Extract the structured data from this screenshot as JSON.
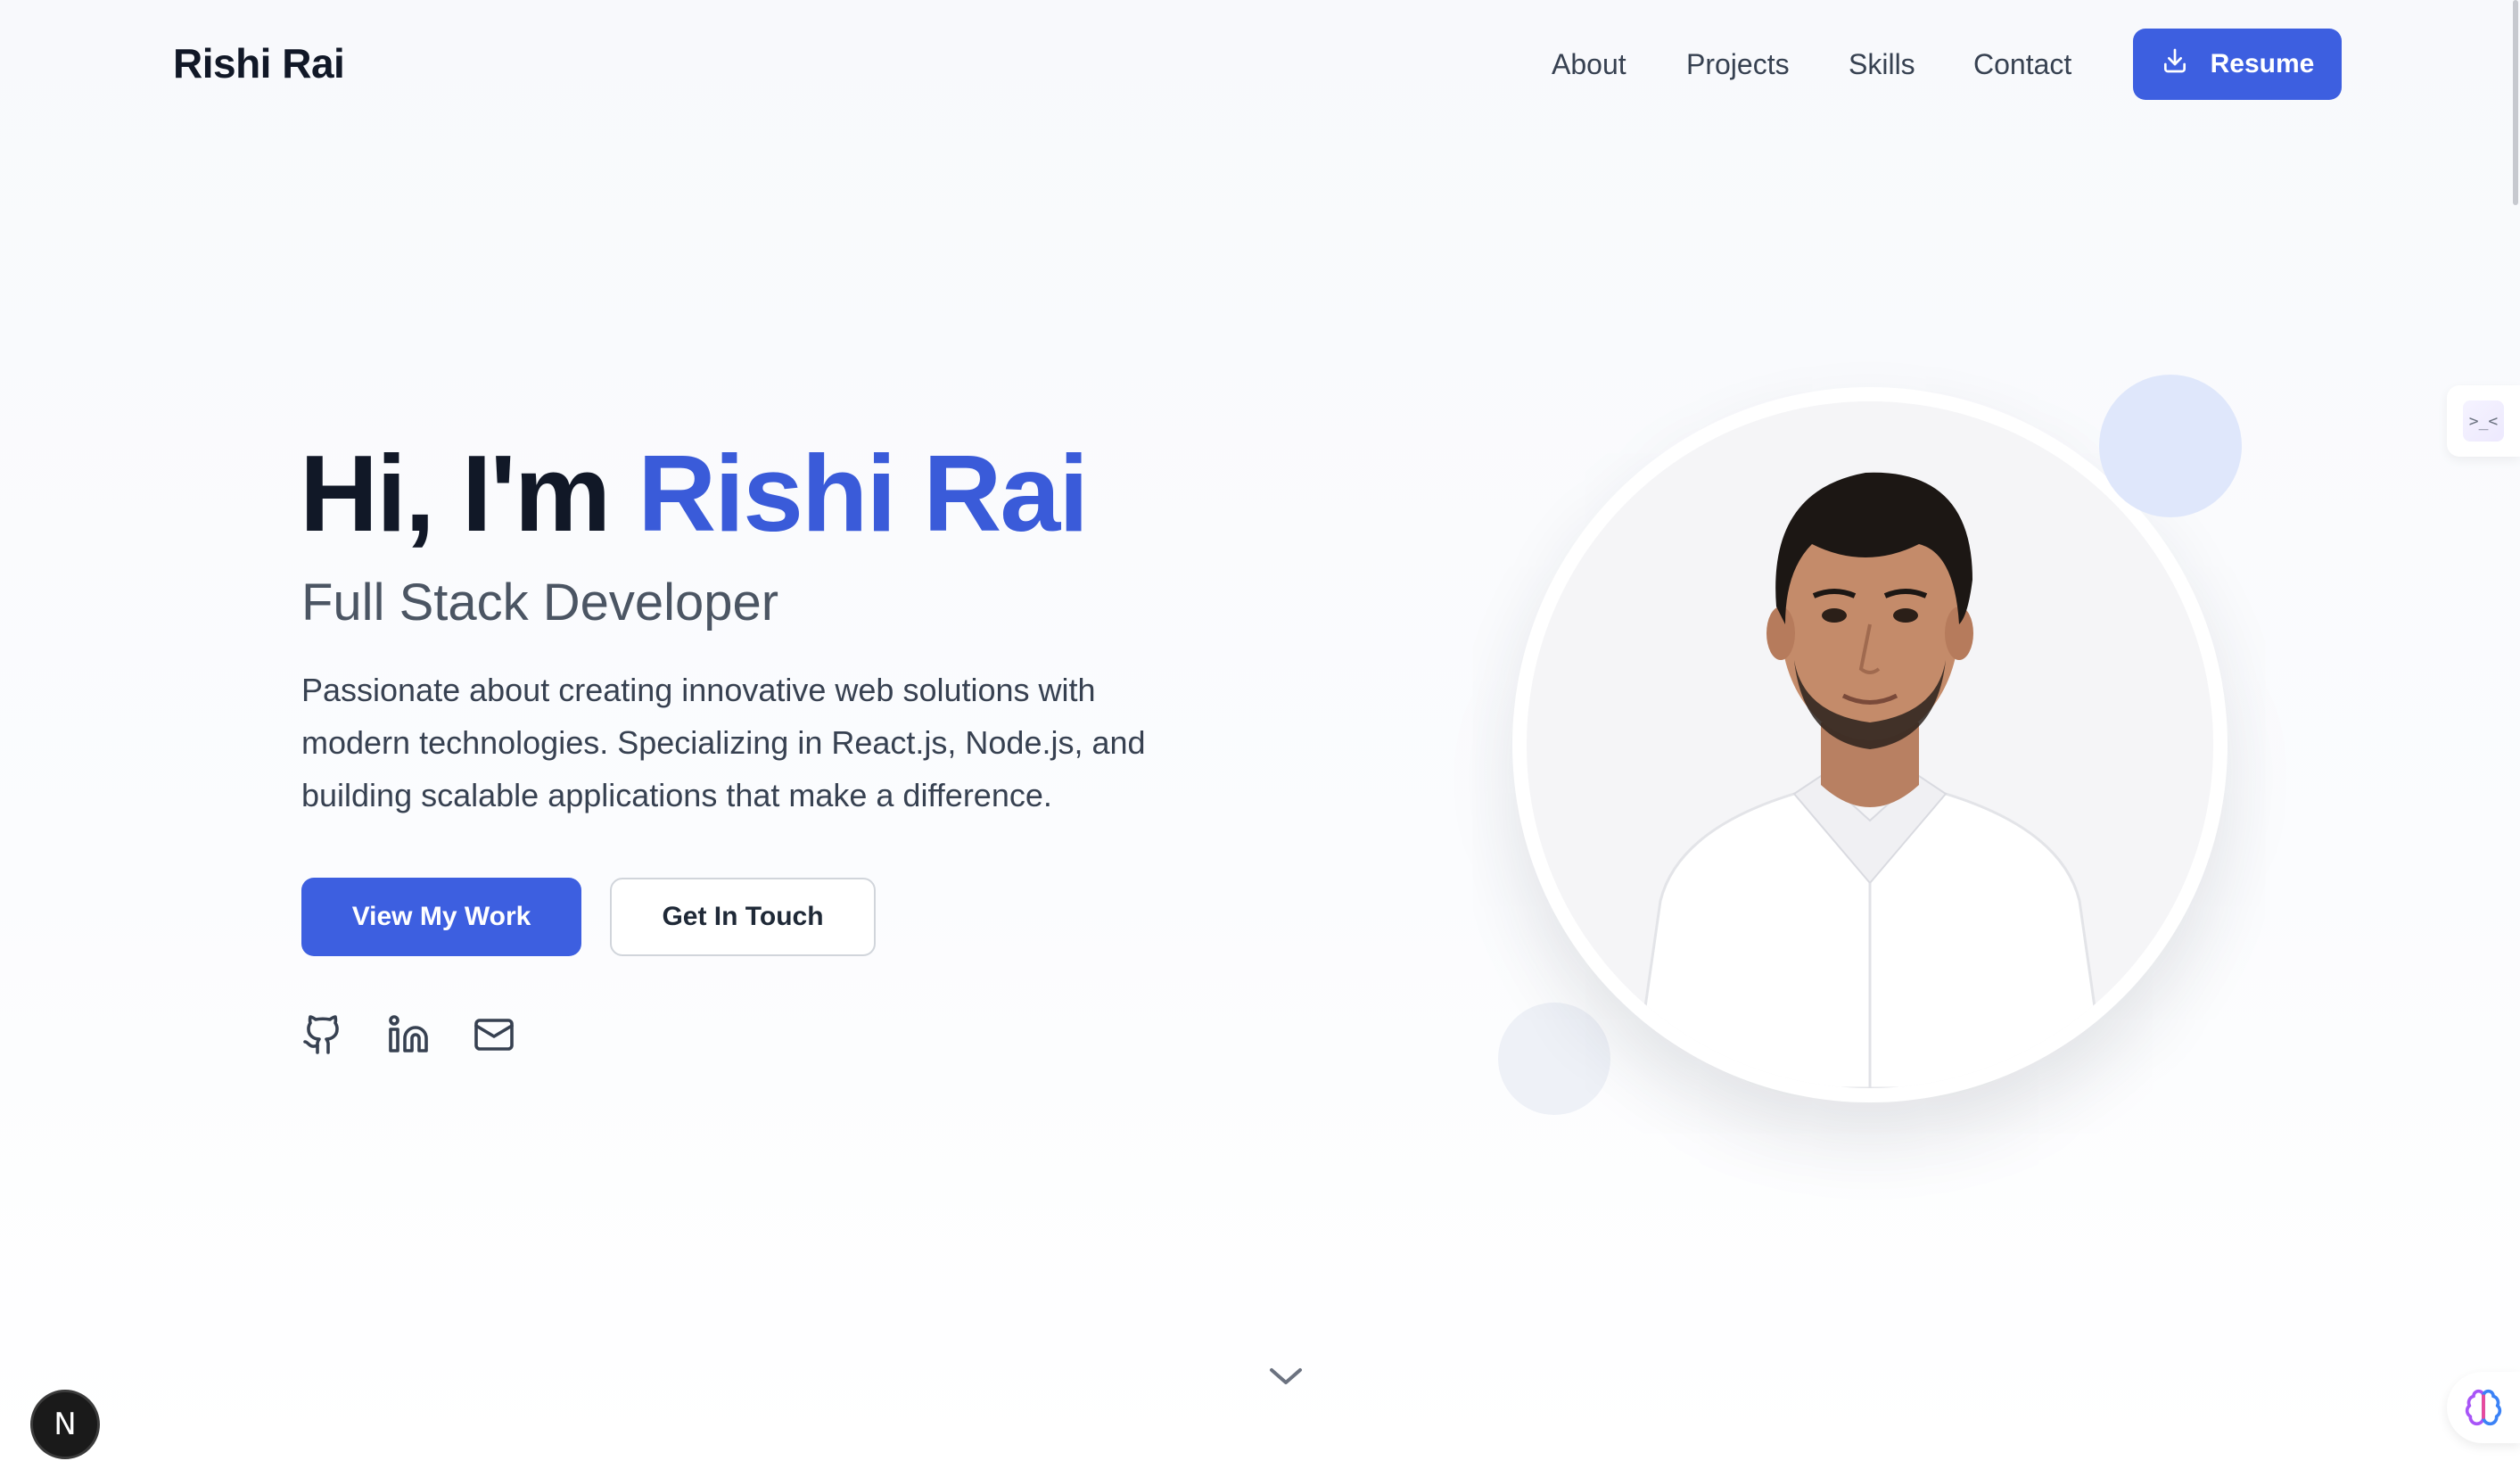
{
  "header": {
    "brand": "Rishi Rai",
    "nav": [
      "About",
      "Projects",
      "Skills",
      "Contact"
    ],
    "resume_label": "Resume"
  },
  "hero": {
    "greeting": "Hi, I'm ",
    "name": "Rishi Rai",
    "subtitle": "Full Stack Developer",
    "description": "Passionate about creating innovative web solutions with modern technologies. Specializing in React.js, Node.js, and building scalable applications that make a difference.",
    "primary_cta": "View My Work",
    "secondary_cta": "Get In Touch"
  },
  "social": [
    "github-icon",
    "linkedin-icon",
    "mail-icon"
  ],
  "floating": {
    "next_badge": "N",
    "side_tab": ">_<"
  },
  "colors": {
    "accent": "#3d5fe0",
    "heading": "#111827",
    "muted": "#4b5563"
  }
}
